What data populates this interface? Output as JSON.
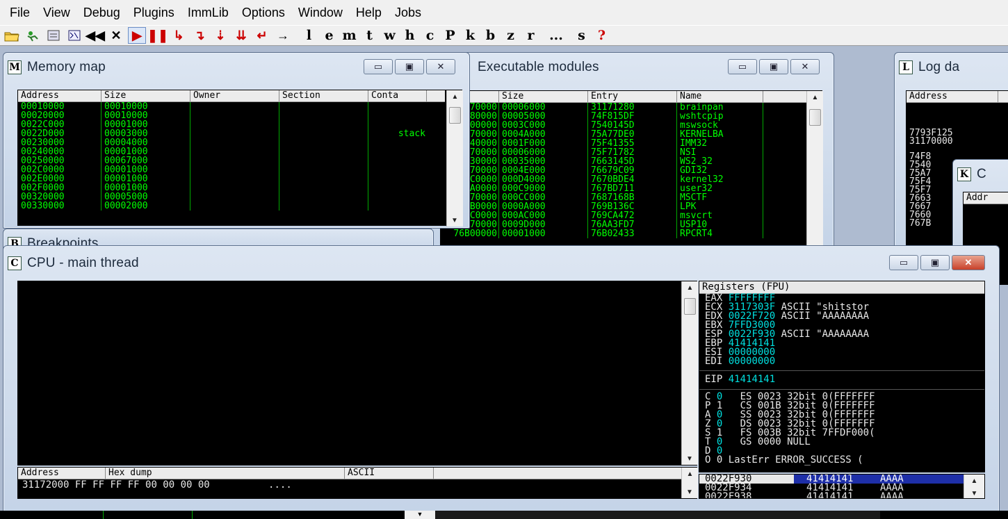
{
  "menu": [
    "File",
    "View",
    "Debug",
    "Plugins",
    "ImmLib",
    "Options",
    "Window",
    "Help",
    "Jobs"
  ],
  "toolbar": {
    "icons": [
      "open-folder-icon",
      "restart-icon",
      "breakpoints-icon",
      "threads-icon",
      "rewind-icon",
      "close-process-icon",
      "run-icon",
      "pause-icon",
      "step-into-icon",
      "step-over-icon",
      "trace-into-icon",
      "trace-over-icon",
      "execute-till-return-icon",
      "goto-icon"
    ],
    "letters": [
      "l",
      "e",
      "m",
      "t",
      "w",
      "h",
      "c",
      "P",
      "k",
      "b",
      "z",
      "r",
      "...",
      "s",
      "?"
    ]
  },
  "memory_map": {
    "icon_letter": "M",
    "title": "Memory map",
    "columns": [
      "Address",
      "Size",
      "Owner",
      "Section",
      "Conta"
    ],
    "rows": [
      [
        "00010000",
        "00010000",
        "",
        "",
        ""
      ],
      [
        "00020000",
        "00010000",
        "",
        "",
        ""
      ],
      [
        "0022C000",
        "00001000",
        "",
        "",
        ""
      ],
      [
        "0022D000",
        "00003000",
        "",
        "",
        "stack"
      ],
      [
        "00230000",
        "00004000",
        "",
        "",
        ""
      ],
      [
        "00240000",
        "00001000",
        "",
        "",
        ""
      ],
      [
        "00250000",
        "00067000",
        "",
        "",
        ""
      ],
      [
        "002C0000",
        "00001000",
        "",
        "",
        ""
      ],
      [
        "002E0000",
        "00001000",
        "",
        "",
        ""
      ],
      [
        "002F0000",
        "00001000",
        "",
        "",
        ""
      ],
      [
        "00320000",
        "00005000",
        "",
        "",
        ""
      ],
      [
        "00330000",
        "00002000",
        "",
        "",
        ""
      ]
    ]
  },
  "exe_modules": {
    "title": "Executable modules",
    "columns": [
      "se",
      "Size",
      "Entry",
      "Name"
    ],
    "rows": [
      [
        "70000",
        "00006000",
        "31171280",
        "brainpan"
      ],
      [
        "F80000",
        "00005000",
        "74F815DF",
        "wshtcpip"
      ],
      [
        "400000",
        "0003C000",
        "7540145D",
        "mswsock"
      ],
      [
        "A70000",
        "0004A000",
        "75A77DE0",
        "KERNELBA"
      ],
      [
        "F40000",
        "0001F000",
        "75F41355",
        "IMM32"
      ],
      [
        "F70000",
        "00006000",
        "75F71782",
        "NSI"
      ],
      [
        "630000",
        "00035000",
        "7663145D",
        "WS2_32"
      ],
      [
        "670000",
        "0004E000",
        "76679C09",
        "GDI32"
      ],
      [
        "6C0000",
        "000D4000",
        "7670BDE4",
        "kernel32"
      ],
      [
        "7A0000",
        "000C9000",
        "767BD711",
        "user32"
      ],
      [
        "870000",
        "000CC000",
        "7687168B",
        "MSCTF"
      ],
      [
        "9B0000",
        "0000A000",
        "769B136C",
        "LPK"
      ],
      [
        "9C0000",
        "000AC000",
        "769CA472",
        "msvcrt"
      ],
      [
        "76A70000",
        "0009D000",
        "76AA3FD7",
        "USP10"
      ],
      [
        "76B00000",
        "00001000",
        "76B02433",
        "RPCRT4"
      ]
    ]
  },
  "log_window": {
    "icon_letter": "L",
    "title": "Log da",
    "column": "Address",
    "values": [
      "7793F125",
      "31170000",
      "74F8",
      "7540",
      "75A7",
      "75F4",
      "75F7",
      "7663",
      "7667",
      "7660",
      "767B"
    ]
  },
  "k_window": {
    "icon_letter": "K",
    "title": "C",
    "column": "Addr"
  },
  "b_window": {
    "icon_letter": "B",
    "title": "Breakpoints"
  },
  "cpu": {
    "icon_letter": "C",
    "title": "CPU - main thread",
    "registers_header": "Registers (FPU)",
    "registers": [
      {
        "name": "EAX",
        "value": "FFFFFFFF",
        "comment": ""
      },
      {
        "name": "ECX",
        "value": "3117303F",
        "comment": "ASCII \"shitstor"
      },
      {
        "name": "EDX",
        "value": "0022F720",
        "comment": "ASCII \"AAAAAAAA"
      },
      {
        "name": "EBX",
        "value": "7FFD3000",
        "comment": ""
      },
      {
        "name": "ESP",
        "value": "0022F930",
        "comment": "ASCII \"AAAAAAAA"
      },
      {
        "name": "EBP",
        "value": "41414141",
        "comment": ""
      },
      {
        "name": "ESI",
        "value": "00000000",
        "comment": ""
      },
      {
        "name": "EDI",
        "value": "00000000",
        "comment": ""
      }
    ],
    "eip": {
      "name": "EIP",
      "value": "41414141"
    },
    "flags": [
      {
        "flag": "C",
        "bit": "0",
        "seg": "ES",
        "sel": "0023",
        "bits": "32bit",
        "base": "0(FFFFFFF"
      },
      {
        "flag": "P",
        "bit": "1",
        "seg": "CS",
        "sel": "001B",
        "bits": "32bit",
        "base": "0(FFFFFFF"
      },
      {
        "flag": "A",
        "bit": "0",
        "seg": "SS",
        "sel": "0023",
        "bits": "32bit",
        "base": "0(FFFFFFF"
      },
      {
        "flag": "Z",
        "bit": "0",
        "seg": "DS",
        "sel": "0023",
        "bits": "32bit",
        "base": "0(FFFFFFF"
      },
      {
        "flag": "S",
        "bit": "1",
        "seg": "FS",
        "sel": "003B",
        "bits": "32bit",
        "base": "7FFDF000("
      },
      {
        "flag": "T",
        "bit": "0",
        "seg": "GS",
        "sel": "0000",
        "bits": "NULL",
        "base": ""
      },
      {
        "flag": "D",
        "bit": "0",
        "seg": "",
        "sel": "",
        "bits": "",
        "base": ""
      }
    ],
    "lasterr": "O 0  LastErr ERROR_SUCCESS (",
    "dump_columns": [
      "Address",
      "Hex dump",
      "ASCII"
    ],
    "dump_row": {
      "address": "31172000",
      "hex": "FF FF FF FF 00 00 00 00",
      "ascii": "...."
    },
    "stack": [
      {
        "addr": "0022F930",
        "val": "41414141",
        "ascii": "AAAA"
      },
      {
        "addr": "0022F934",
        "val": "41414141",
        "ascii": "AAAA"
      },
      {
        "addr": "0022F938",
        "val": "41414141",
        "ascii": "AAAA"
      }
    ]
  }
}
